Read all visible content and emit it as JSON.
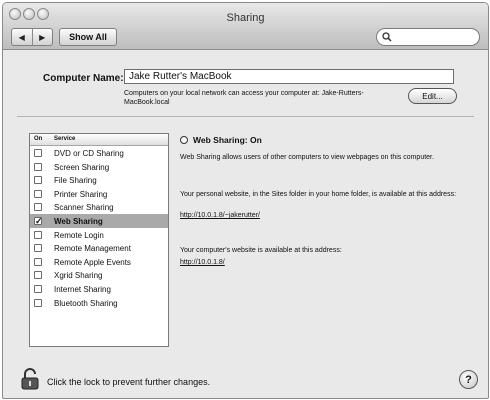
{
  "window": {
    "title": "Sharing"
  },
  "toolbar": {
    "show_all_label": "Show All",
    "back_glyph": "◀",
    "forward_glyph": "▶",
    "search_placeholder": ""
  },
  "computer_name": {
    "label": "Computer Name:",
    "value": "Jake Rutter's MacBook",
    "description": "Computers on your local network can access your computer at: Jake-Rutters-MacBook.local",
    "edit_label": "Edit..."
  },
  "services": {
    "header_on": "On",
    "header_service": "Service",
    "items": [
      {
        "label": "DVD or CD Sharing",
        "on": false
      },
      {
        "label": "Screen Sharing",
        "on": false
      },
      {
        "label": "File Sharing",
        "on": false
      },
      {
        "label": "Printer Sharing",
        "on": false
      },
      {
        "label": "Scanner Sharing",
        "on": false
      },
      {
        "label": "Web Sharing",
        "on": true,
        "selected": true
      },
      {
        "label": "Remote Login",
        "on": false
      },
      {
        "label": "Remote Management",
        "on": false
      },
      {
        "label": "Remote Apple Events",
        "on": false
      },
      {
        "label": "Xgrid Sharing",
        "on": false
      },
      {
        "label": "Internet Sharing",
        "on": false
      },
      {
        "label": "Bluetooth Sharing",
        "on": false
      }
    ]
  },
  "detail": {
    "status": "Web Sharing: On",
    "description": "Web Sharing allows users of other computers to view webpages on this computer.",
    "personal_text": "Your personal website, in the Sites folder in your home folder, is available at this address:",
    "personal_url": "http://10.0.1.8/~jakerutter/",
    "computer_text": "Your computer's website is available at this address:",
    "computer_url": "http://10.0.1.8/"
  },
  "footer": {
    "lock_message": "Click the lock to prevent further changes.",
    "help_label": "?"
  },
  "icons": {
    "check": "✓",
    "lock": "lock-icon",
    "search": "search-icon"
  }
}
